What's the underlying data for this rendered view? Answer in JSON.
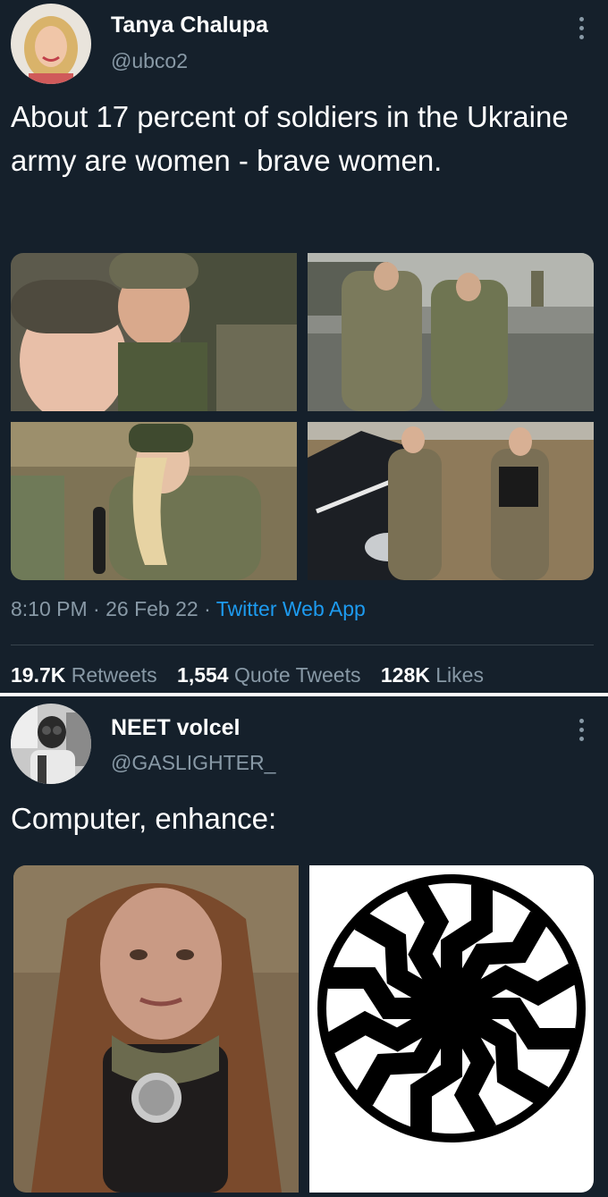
{
  "tweet1": {
    "author": {
      "name": "Tanya Chalupa",
      "handle": "@ubco2"
    },
    "text": "About 17 percent of soldiers in the Ukraine army are women - brave women.",
    "time": "8:10 PM",
    "date": "26 Feb 22",
    "sep": "·",
    "source": "Twitter Web App",
    "stats": {
      "retweets_count": "19.7K",
      "retweets_label": "Retweets",
      "quotes_count": "1,554",
      "quotes_label": "Quote Tweets",
      "likes_count": "128K",
      "likes_label": "Likes"
    },
    "media": [
      "photo",
      "photo",
      "photo",
      "photo"
    ]
  },
  "tweet2": {
    "author": {
      "name": "NEET volcel",
      "handle": "@GASLIGHTER_"
    },
    "text": "Computer, enhance:",
    "media": [
      "photo",
      "black-sun-symbol"
    ]
  },
  "colors": {
    "background": "#15202b",
    "secondary_text": "#8899a6",
    "link": "#1d9bf0",
    "divider": "#38444d"
  },
  "icons": [
    "more-icon"
  ]
}
